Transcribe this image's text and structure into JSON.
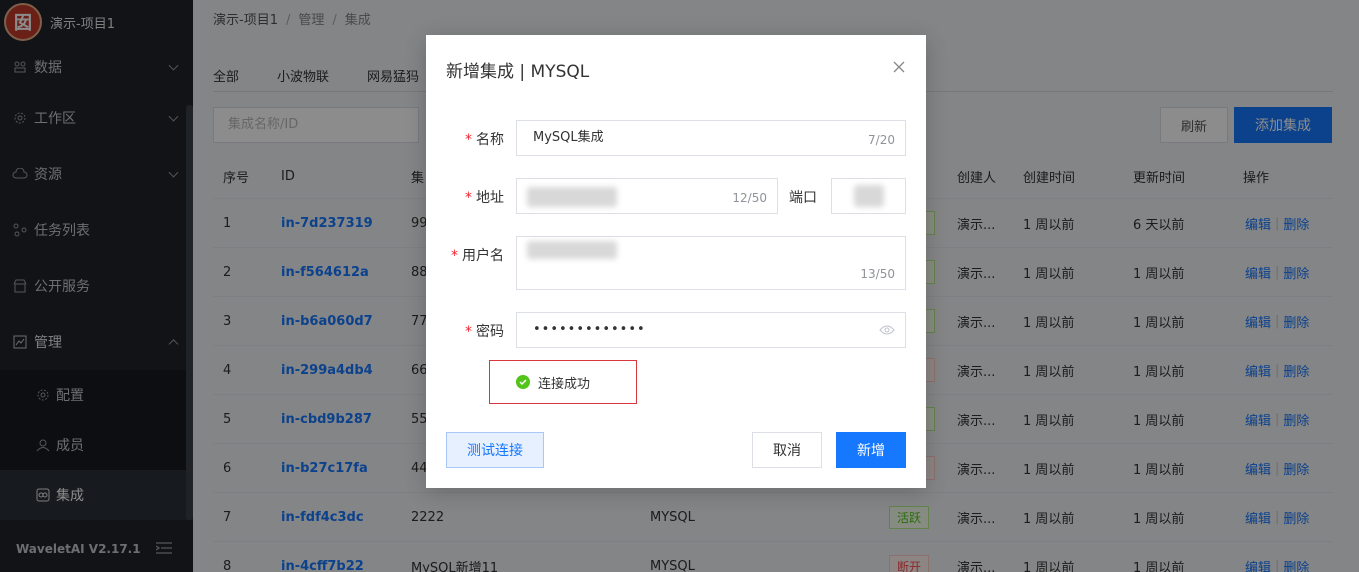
{
  "sidebar": {
    "brand": "演示-项目1",
    "logo_char": "囡",
    "items": [
      {
        "label": "数据",
        "icon": "data-icon"
      },
      {
        "label": "工作区",
        "icon": "gear-icon"
      },
      {
        "label": "资源",
        "icon": "cloud-icon"
      },
      {
        "label": "任务列表",
        "icon": "task-icon"
      },
      {
        "label": "公开服务",
        "icon": "store-icon"
      },
      {
        "label": "管理",
        "icon": "chart-icon"
      }
    ],
    "sub_items": [
      {
        "label": "配置",
        "icon": "gear-icon"
      },
      {
        "label": "成员",
        "icon": "user-icon"
      },
      {
        "label": "集成",
        "icon": "integration-icon"
      }
    ],
    "version": "WaveletAI V2.17.1"
  },
  "breadcrumb": [
    "演示-项目1",
    "管理",
    "集成"
  ],
  "tabs": [
    "全部",
    "小波物联",
    "网易猛犸"
  ],
  "search": {
    "placeholder": "集成名称/ID"
  },
  "toolbar": {
    "refresh": "刷新",
    "add": "添加集成"
  },
  "table": {
    "headers": {
      "index": "序号",
      "id": "ID",
      "name": "集",
      "creator": "创建人",
      "created": "创建时间",
      "updated": "更新时间",
      "ops": "操作"
    },
    "rows": [
      {
        "index": "1",
        "id": "in-7d237319",
        "name": "99",
        "type": "",
        "status": "",
        "status_type": "active",
        "creator": "演示...",
        "created": "1 周以前",
        "updated": "6 天以前"
      },
      {
        "index": "2",
        "id": "in-f564612a",
        "name": "88",
        "type": "",
        "status": "",
        "status_type": "active",
        "creator": "演示...",
        "created": "1 周以前",
        "updated": "1 周以前"
      },
      {
        "index": "3",
        "id": "in-b6a060d7",
        "name": "77",
        "type": "",
        "status": "",
        "status_type": "active",
        "creator": "演示...",
        "created": "1 周以前",
        "updated": "1 周以前"
      },
      {
        "index": "4",
        "id": "in-299a4db4",
        "name": "66",
        "type": "",
        "status": "",
        "status_type": "broken",
        "creator": "演示...",
        "created": "1 周以前",
        "updated": "1 周以前"
      },
      {
        "index": "5",
        "id": "in-cbd9b287",
        "name": "55",
        "type": "",
        "status": "",
        "status_type": "active",
        "creator": "演示...",
        "created": "1 周以前",
        "updated": "1 周以前"
      },
      {
        "index": "6",
        "id": "in-b27c17fa",
        "name": "44",
        "type": "",
        "status": "",
        "status_type": "broken",
        "creator": "演示...",
        "created": "1 周以前",
        "updated": "1 周以前"
      },
      {
        "index": "7",
        "id": "in-fdf4c3dc",
        "name": "2222",
        "type": "MYSQL",
        "status": "活跃",
        "status_type": "active",
        "creator": "演示...",
        "created": "1 周以前",
        "updated": "1 周以前"
      },
      {
        "index": "8",
        "id": "in-4cff7b22",
        "name": "MySQL新增11",
        "type": "MYSQL",
        "status": "断开",
        "status_type": "broken",
        "creator": "演示...",
        "created": "1 周以前",
        "updated": "1 周以前"
      }
    ],
    "op_edit": "编辑",
    "op_delete": "删除"
  },
  "modal": {
    "title": "新增集成 | MYSQL",
    "name_label": "名称",
    "name_value": "MySQL集成",
    "name_count": "7/20",
    "host_label": "地址",
    "host_count": "12/50",
    "port_label": "端口",
    "user_label": "用户名",
    "user_count": "13/50",
    "password_label": "密码",
    "password_value": "•••••••••••••",
    "success_text": "连接成功",
    "test_button": "测试连接",
    "cancel_button": "取消",
    "create_button": "新增"
  }
}
